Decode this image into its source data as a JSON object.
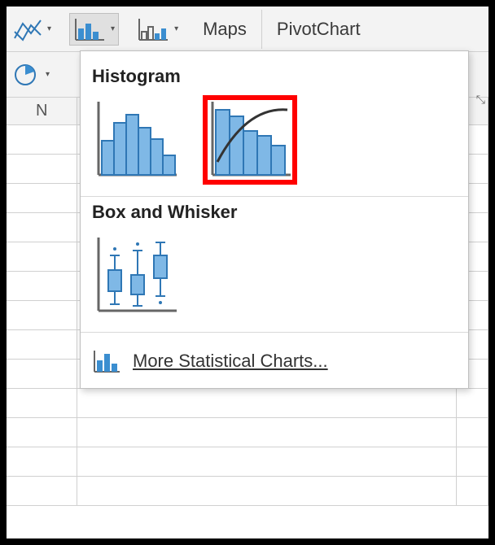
{
  "ribbon": {
    "maps_label": "Maps",
    "pivotchart_label": "PivotChart"
  },
  "grid": {
    "col_N": "N"
  },
  "dropdown": {
    "histogram_title": "Histogram",
    "boxwhisker_title": "Box and Whisker",
    "more_label": "More Statistical Charts..."
  }
}
